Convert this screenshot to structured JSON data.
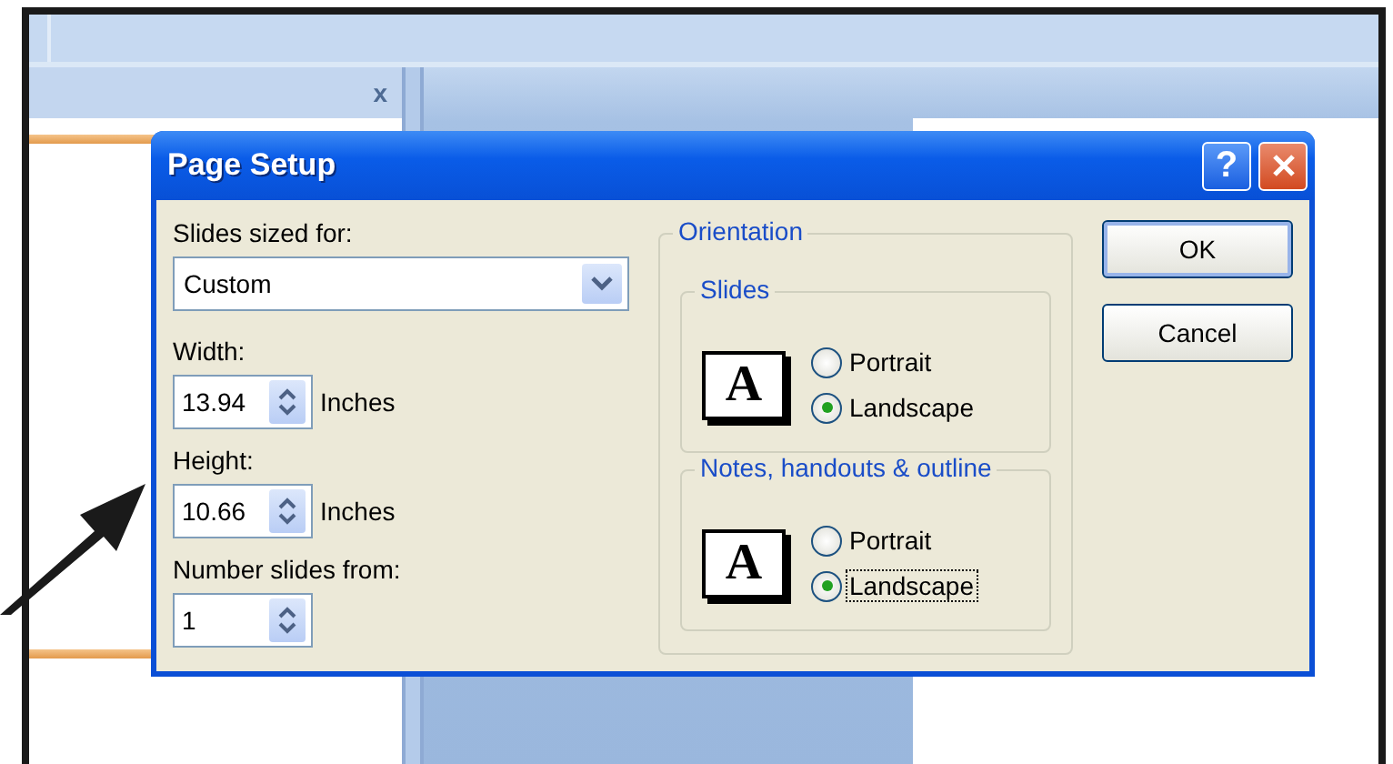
{
  "background": {
    "pane_close": "x"
  },
  "dialog": {
    "title": "Page Setup",
    "help_label": "?"
  },
  "slides_sized_for": {
    "label": "Slides sized for:",
    "value": "Custom"
  },
  "size_fields": [
    {
      "label": "Width:",
      "value": "13.94",
      "unit": "Inches"
    },
    {
      "label": "Height:",
      "value": "10.66",
      "unit": "Inches"
    }
  ],
  "number_slides_from": {
    "label": "Number slides from:",
    "value": "1"
  },
  "orientation": {
    "title": "Orientation",
    "groups": [
      {
        "title": "Slides",
        "icon_text": "A",
        "options": [
          {
            "label": "Portrait",
            "selected": false,
            "focused": false
          },
          {
            "label": "Landscape",
            "selected": true,
            "focused": false
          }
        ]
      },
      {
        "title": "Notes, handouts & outline",
        "icon_text": "A",
        "options": [
          {
            "label": "Portrait",
            "selected": false,
            "focused": false
          },
          {
            "label": "Landscape",
            "selected": true,
            "focused": true
          }
        ]
      }
    ]
  },
  "buttons": [
    {
      "label": "OK",
      "default": true
    },
    {
      "label": "Cancel",
      "default": false
    }
  ]
}
